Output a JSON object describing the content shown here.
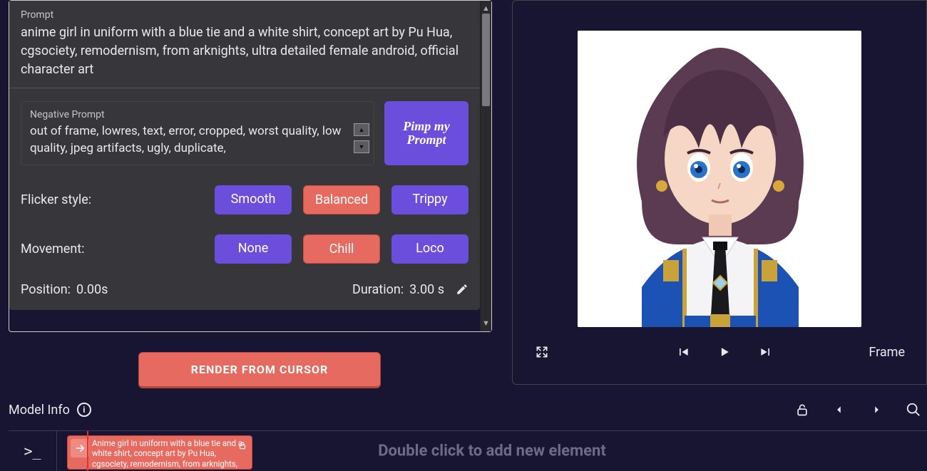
{
  "prompt": {
    "label": "Prompt",
    "text": "anime girl in uniform with a blue tie and a white shirt, concept art by Pu Hua, cgsociety, remodernism, from arknights, ultra detailed female android, official character art"
  },
  "negative_prompt": {
    "label": "Negative Prompt",
    "text": "out of frame, lowres, text, error, cropped, worst quality, low quality, jpeg artifacts, ugly, duplicate,"
  },
  "pimp_btn": "Pimp my Prompt",
  "flicker": {
    "label": "Flicker style:",
    "options": [
      "Smooth",
      "Balanced",
      "Trippy"
    ],
    "selected": "Balanced"
  },
  "movement": {
    "label": "Movement:",
    "options": [
      "None",
      "Chill",
      "Loco"
    ],
    "selected": "Chill"
  },
  "position": {
    "label": "Position:",
    "value": "0.00s"
  },
  "duration": {
    "label": "Duration:",
    "value": "3.00 s"
  },
  "render_btn": "RENDER FROM CURSOR",
  "preview": {
    "frame_label": "Frame"
  },
  "model_info": "Model Info",
  "timeline": {
    "element_text": "Anime girl in uniform with a blue tie and a white shirt, concept art by Pu Hua, cgsociety, remodernism, from arknights,",
    "hint": "Double click to add new element"
  }
}
